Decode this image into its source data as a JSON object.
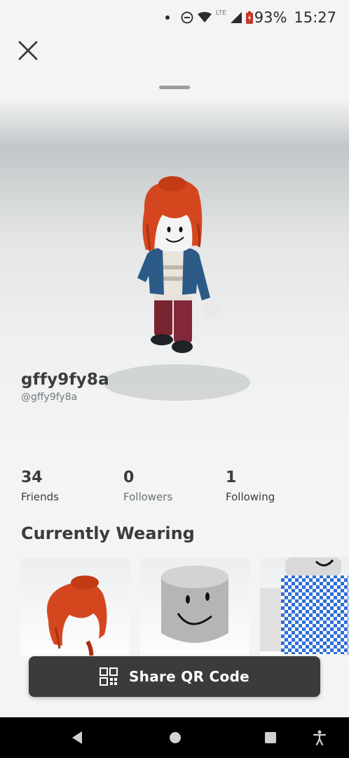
{
  "status_bar": {
    "battery_percent": "93%",
    "time": "15:27",
    "network_label": "LTE"
  },
  "profile": {
    "display_name": "gffy9fy8a",
    "username": "@gffy9fy8a"
  },
  "stats": [
    {
      "value": "34",
      "label": "Friends"
    },
    {
      "value": "0",
      "label": "Followers"
    },
    {
      "value": "1",
      "label": "Following"
    }
  ],
  "wearing": {
    "title": "Currently Wearing",
    "items": [
      {
        "icon": "hair-item-icon"
      },
      {
        "icon": "head-item-icon"
      },
      {
        "icon": "shirt-item-icon"
      }
    ]
  },
  "share_button": {
    "label": "Share QR Code",
    "icon": "qr-code-icon"
  },
  "colors": {
    "background": "#f2f4f5",
    "button_dark": "#393b3d",
    "text_primary": "#393b3d",
    "hair": "#d4471e",
    "jacket": "#2b5a86",
    "pants": "#7a2430"
  }
}
